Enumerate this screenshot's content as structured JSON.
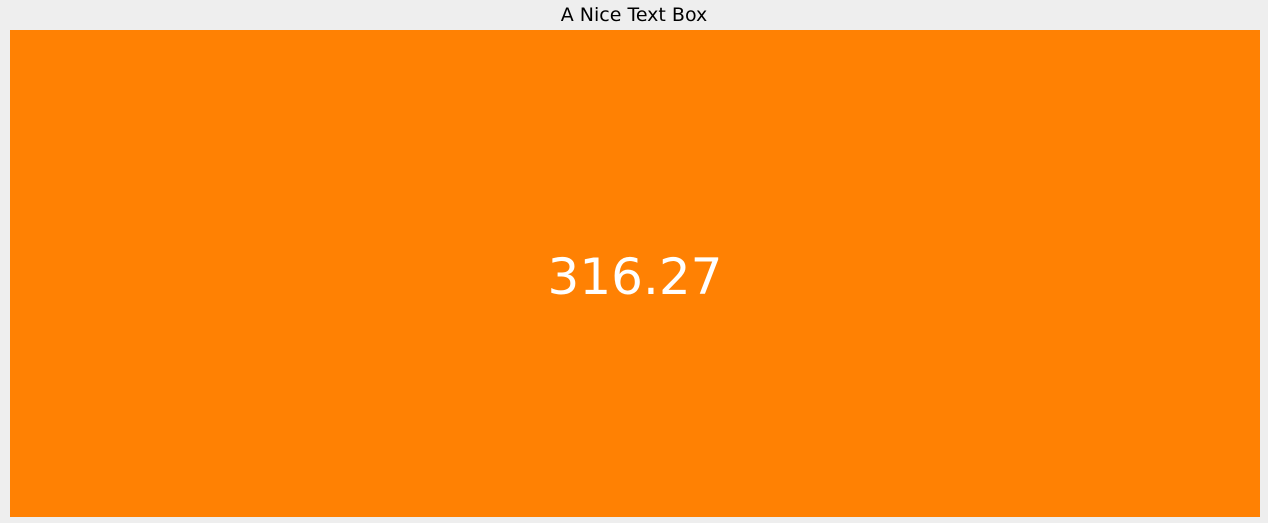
{
  "widget": {
    "title": "A Nice Text Box",
    "value": "316.27",
    "box_color": "#ff8103",
    "text_color": "#ffffff",
    "background_color": "#eeeeee"
  }
}
